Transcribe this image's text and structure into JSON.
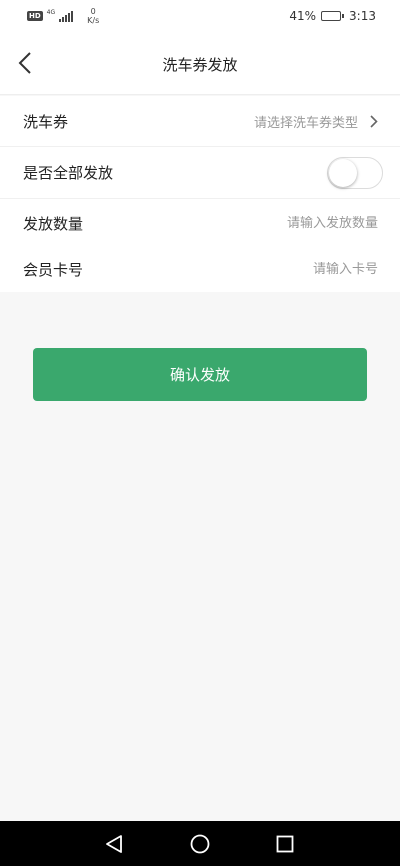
{
  "status_bar": {
    "hd": "HD",
    "network": "4G",
    "net_speed_value": "0",
    "net_speed_unit": "K/s",
    "battery_percent": "41%",
    "battery_level": 0.41,
    "time": "3:13"
  },
  "header": {
    "title": "洗车券发放",
    "back_icon": "chevron-left-icon"
  },
  "form": {
    "coupon": {
      "label": "洗车券",
      "placeholder": "请选择洗车券类型"
    },
    "issue_all": {
      "label": "是否全部发放",
      "enabled": false
    },
    "quantity": {
      "label": "发放数量",
      "placeholder": "请输入发放数量",
      "value": ""
    },
    "member_card": {
      "label": "会员卡号",
      "placeholder": "请输入卡号",
      "value": ""
    }
  },
  "actions": {
    "confirm_label": "确认发放"
  },
  "colors": {
    "accent": "#3aa86d",
    "background": "#f7f7f7"
  },
  "system_nav": {
    "back": "triangle-back-icon",
    "home": "circle-home-icon",
    "recents": "square-recents-icon"
  }
}
